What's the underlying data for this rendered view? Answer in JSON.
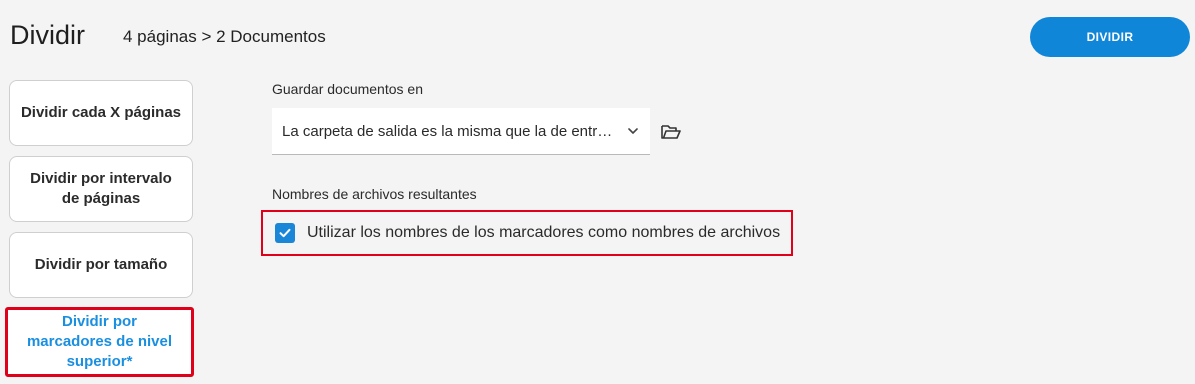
{
  "header": {
    "title": "Dividir",
    "summary": "4 páginas > 2 Documentos",
    "action_label": "DIVIDIR"
  },
  "split_modes": [
    {
      "label": "Dividir cada X páginas",
      "selected": false
    },
    {
      "label": "Dividir por intervalo de páginas",
      "selected": false
    },
    {
      "label": "Dividir por tamaño",
      "selected": false
    },
    {
      "label": "Dividir por marcadores de nivel superior*",
      "selected": true
    }
  ],
  "output": {
    "label": "Guardar documentos en",
    "value": "La carpeta de salida es la misma que la de entrada",
    "browse_icon": "folder-open-icon"
  },
  "filenames": {
    "label": "Nombres de archivos resultantes",
    "checkbox_label": "Utilizar los nombres de los marcadores como nombres de archivos",
    "checked": true
  },
  "colors": {
    "accent": "#0f86d8",
    "highlight": "#e0001a",
    "selected_text": "#1a8fe0"
  }
}
